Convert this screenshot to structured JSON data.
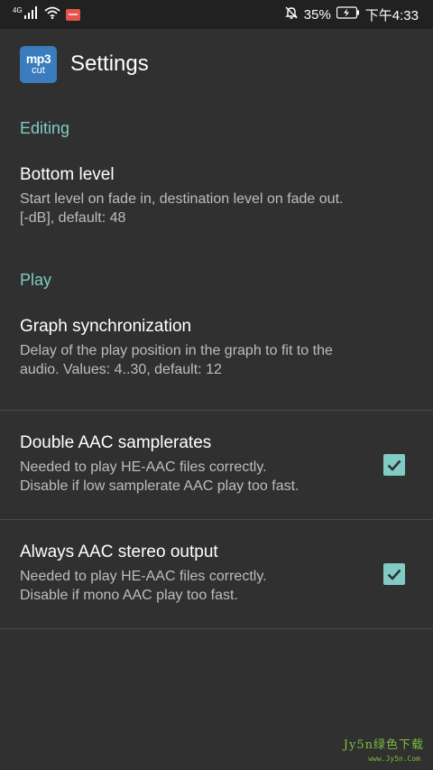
{
  "status_bar": {
    "network": "4G",
    "battery_percent": "35%",
    "time": "下午4:33",
    "icons": [
      "signal-icon",
      "wifi-icon",
      "app-notification-icon",
      "mute-bell-icon",
      "battery-icon"
    ]
  },
  "toolbar": {
    "logo_top": "mp3",
    "logo_bottom": "cut",
    "title": "Settings"
  },
  "categories": {
    "editing": "Editing",
    "play": "Play"
  },
  "prefs": {
    "bottom_level": {
      "title": "Bottom level",
      "summary": "Start level on fade in, destination level on fade out.\n[-dB], default: 48"
    },
    "graph_sync": {
      "title": "Graph synchronization",
      "summary": "Delay of the play position in the graph to fit to the\naudio. Values: 4..30, default: 12"
    },
    "double_aac": {
      "title": "Double AAC samplerates",
      "summary": "Needed to play HE-AAC files correctly.\nDisable if low samplerate AAC play too fast.",
      "checked": true
    },
    "aac_stereo": {
      "title": "Always AAC stereo output",
      "summary": "Needed to play HE-AAC files correctly.\nDisable if mono AAC play too fast.",
      "checked": true
    }
  },
  "watermark": {
    "text": "Jy5n绿色下载",
    "sub": "www.Jy5n.Com"
  },
  "colors": {
    "accent": "#80cbc4",
    "background": "#303030",
    "status_bar": "#212121",
    "logo": "#3a7cbd"
  }
}
